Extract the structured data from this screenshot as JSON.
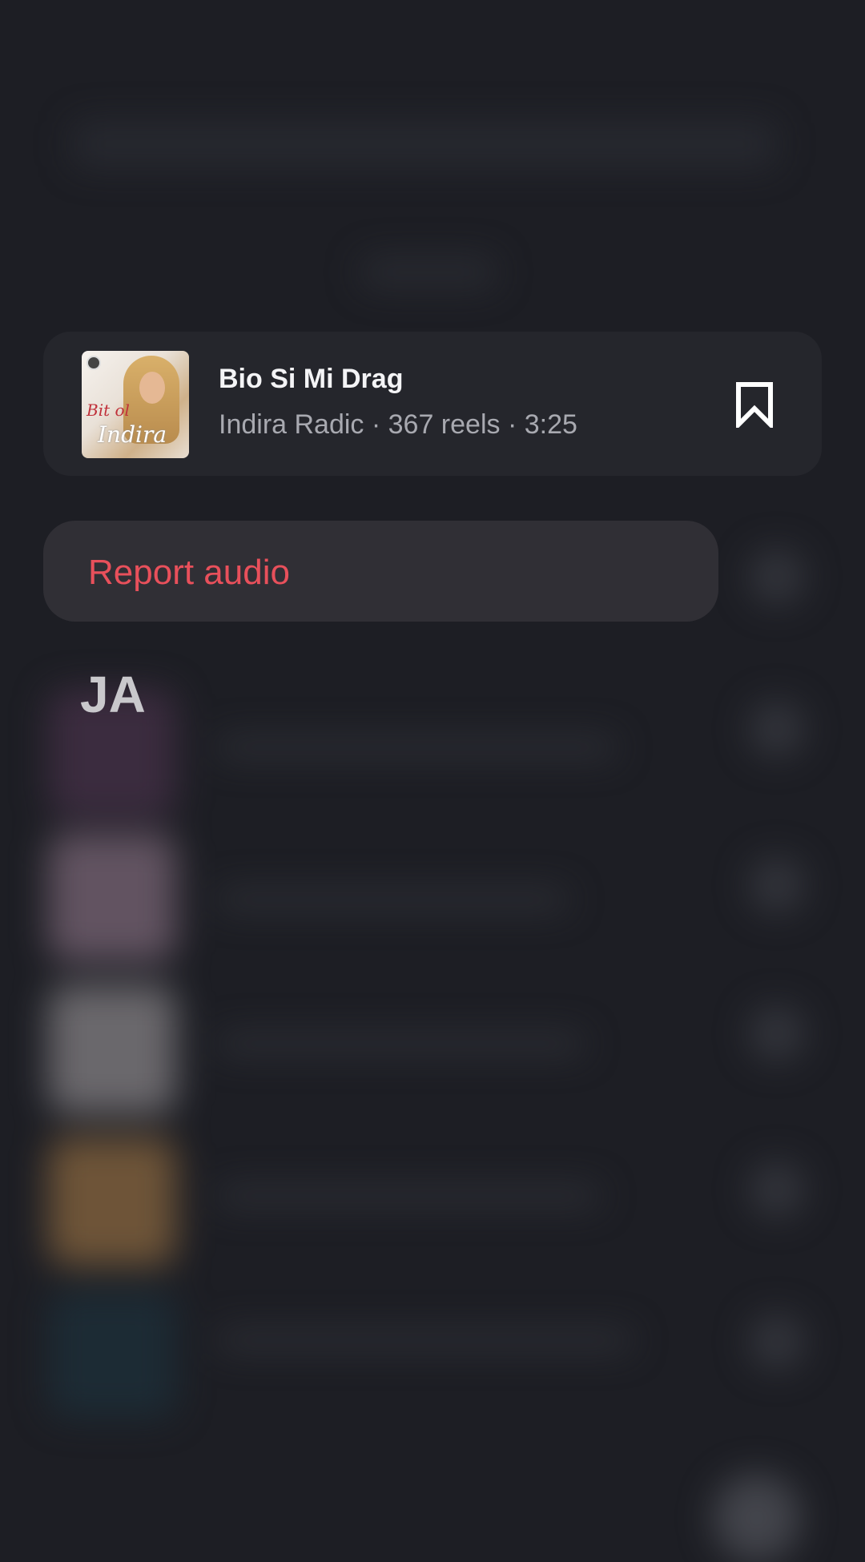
{
  "audio_card": {
    "title": "Bio Si Mi Drag",
    "meta": "Indira Radic · 367 reels · 3:25",
    "cover_text_red": "Bit ol",
    "cover_text_white": "Indira"
  },
  "menu": {
    "report_label": "Report audio"
  },
  "section_heading": "JA",
  "colors": {
    "background": "#1d1e24",
    "card": "#25262c",
    "menu": "#302f35",
    "danger": "#e8505b",
    "title": "#f4f4f6",
    "meta": "#a8a9b0"
  },
  "icons": {
    "bookmark": "bookmark-icon"
  }
}
